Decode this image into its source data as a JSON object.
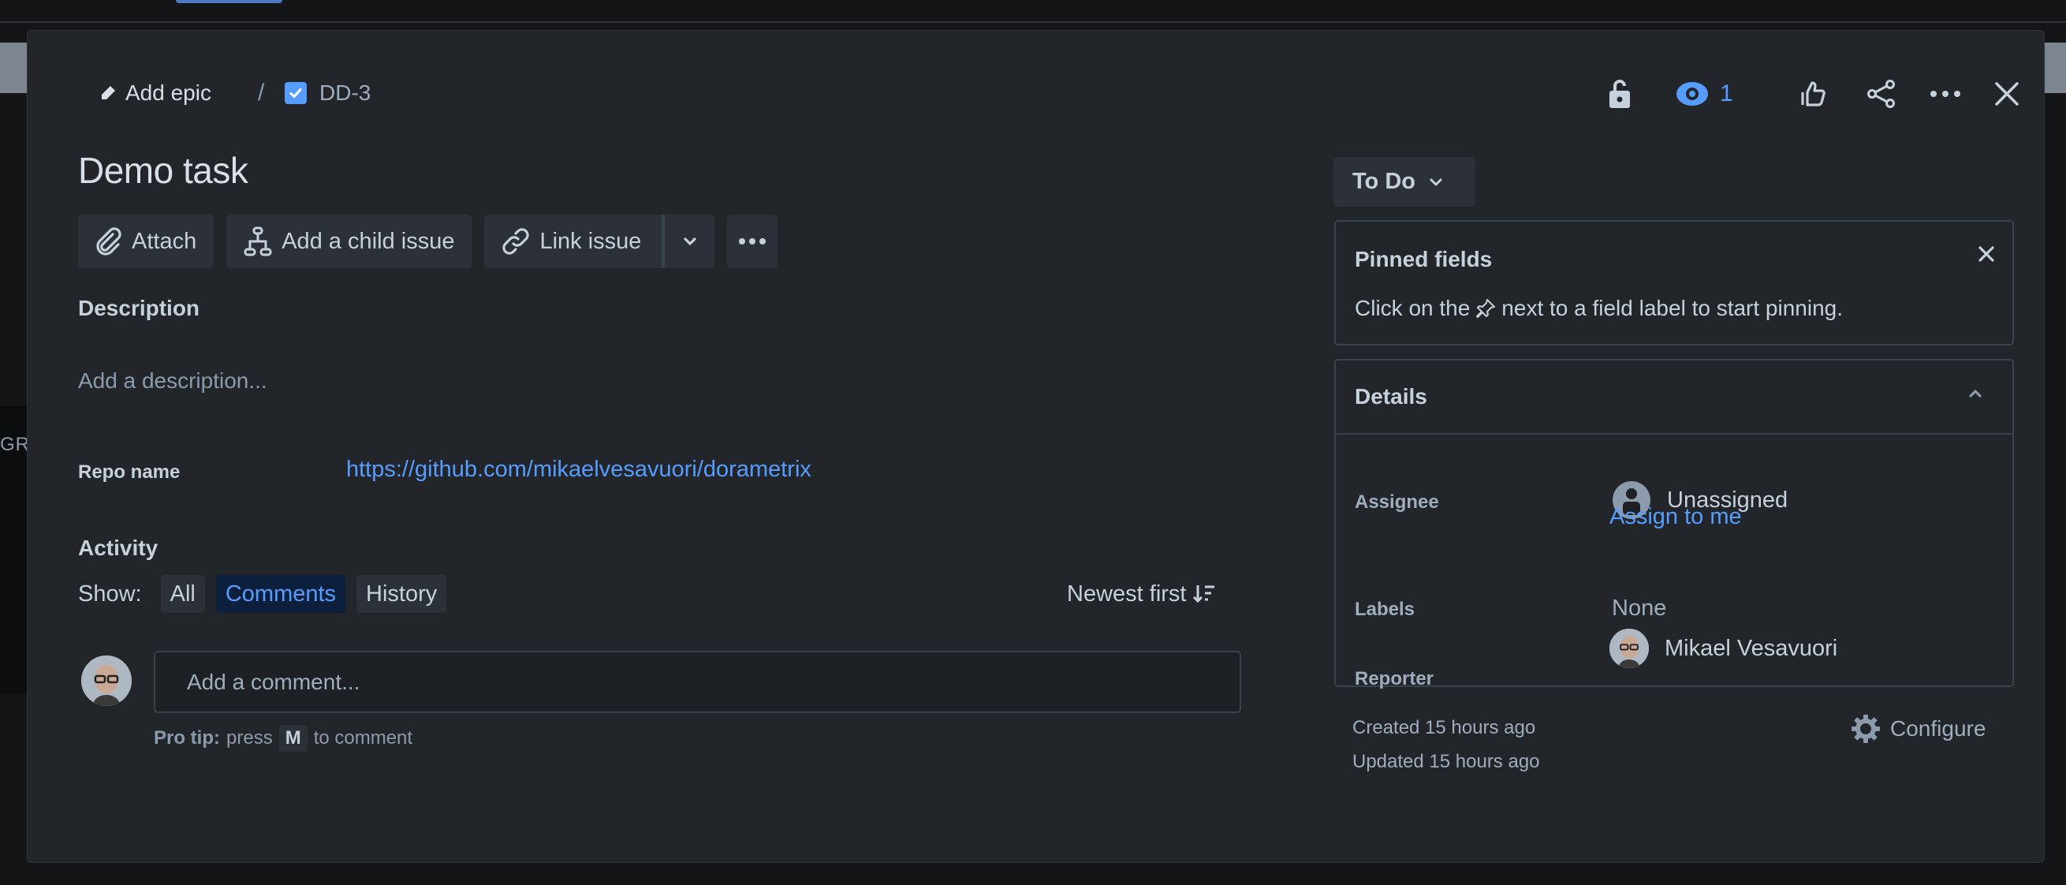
{
  "background": {
    "partial_text": "GRE"
  },
  "breadcrumb": {
    "add_epic": "Add epic",
    "separator": "/",
    "issue_key": "DD-3",
    "issue_type_icon": "checkbox-icon"
  },
  "header_actions": {
    "lock_icon": "unlock-icon",
    "watchers_count": "1",
    "like_icon": "thumbs-up-icon",
    "share_icon": "share-icon",
    "more_icon": "more-icon",
    "close_icon": "close-icon"
  },
  "issue": {
    "title": "Demo task"
  },
  "toolbar": {
    "attach": "Attach",
    "add_child": "Add a child issue",
    "link_issue": "Link issue"
  },
  "description": {
    "heading": "Description",
    "placeholder": "Add a description..."
  },
  "custom_fields": [
    {
      "label": "Repo name",
      "value": "https://github.com/mikaelvesavuori/dorametrix"
    }
  ],
  "activity": {
    "heading": "Activity",
    "show_label": "Show:",
    "filters": [
      {
        "label": "All",
        "active": false
      },
      {
        "label": "Comments",
        "active": true
      },
      {
        "label": "History",
        "active": false
      }
    ],
    "sort": "Newest first",
    "comment_placeholder": "Add a comment...",
    "pro_tip_label": "Pro tip:",
    "pro_tip_press": "press",
    "pro_tip_key": "M",
    "pro_tip_suffix": "to comment"
  },
  "status": {
    "label": "To Do"
  },
  "pinned": {
    "title": "Pinned fields",
    "text_before": "Click on the",
    "text_after": "next to a field label to start pinning."
  },
  "details": {
    "title": "Details",
    "assignee_label": "Assignee",
    "assignee_value": "Unassigned",
    "assign_to_me": "Assign to me",
    "labels_label": "Labels",
    "labels_value": "None",
    "reporter_label": "Reporter",
    "reporter_value": "Mikael Vesavuori"
  },
  "meta": {
    "created": "Created 15 hours ago",
    "updated": "Updated 15 hours ago",
    "configure": "Configure"
  },
  "colors": {
    "accent": "#579dff",
    "surface": "#22262b",
    "button": "#2c3038",
    "active_pill_bg": "#0c1f3d"
  }
}
